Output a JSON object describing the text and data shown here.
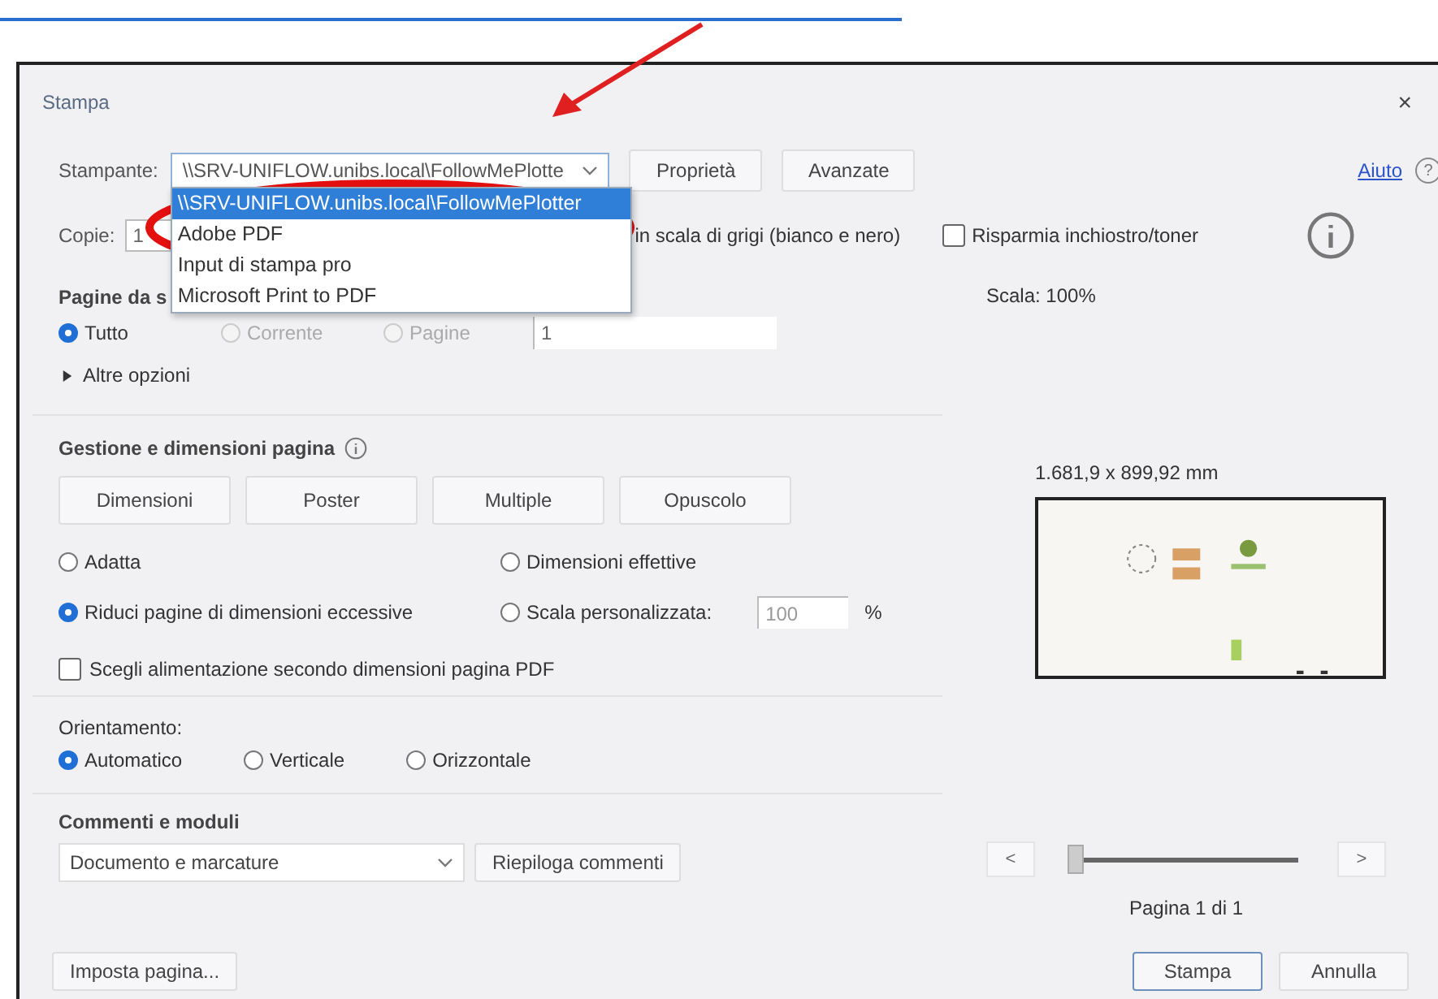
{
  "dialog": {
    "title": "Stampa",
    "close": "×"
  },
  "printer": {
    "label": "Stampante:",
    "value": "\\\\SRV-UNIFLOW.unibs.local\\FollowMePlotte",
    "expanded": true,
    "options": [
      {
        "label": "\\\\SRV-UNIFLOW.unibs.local\\FollowMePlotter",
        "selected": true
      },
      {
        "label": "Adobe PDF",
        "selected": false
      },
      {
        "label": "Input di stampa pro",
        "selected": false
      },
      {
        "label": "Microsoft Print to PDF",
        "selected": false
      }
    ]
  },
  "top_buttons": [
    "Proprietà",
    "Avanzate"
  ],
  "help": {
    "label": "Aiuto",
    "icon": "?"
  },
  "copies": {
    "label": "Copie:",
    "value": "1"
  },
  "grayscale": {
    "label": "in scala di grigi (bianco e nero)"
  },
  "save_ink": {
    "label": "Risparmia inchiostro/toner",
    "checked": false
  },
  "pages": {
    "title": "Pagine da s",
    "radios": [
      {
        "label": "Tutto",
        "selected": true,
        "disabled": false
      },
      {
        "label": "Corrente",
        "selected": false,
        "disabled": true
      },
      {
        "label": "Pagine",
        "selected": false,
        "disabled": true
      }
    ],
    "range": "1",
    "more": {
      "label": "Altre opzioni",
      "expanded": false
    }
  },
  "page_handling": {
    "title": "Gestione e dimensioni pagina",
    "buttons": [
      "Dimensioni",
      "Poster",
      "Multiple",
      "Opuscolo"
    ],
    "radios": [
      {
        "label": "Adatta",
        "selected": false
      },
      {
        "label": "Dimensioni effettive",
        "selected": false
      },
      {
        "label": "Riduci pagine di dimensioni eccessive",
        "selected": true
      },
      {
        "label": "Scala personalizzata:",
        "selected": false
      }
    ],
    "custom_scale": "100",
    "unit": "%",
    "paper_source": {
      "label": "Scegli alimentazione secondo dimensioni pagina PDF",
      "checked": false
    }
  },
  "orientation": {
    "label": "Orientamento:",
    "radios": [
      {
        "label": "Automatico",
        "selected": true
      },
      {
        "label": "Verticale",
        "selected": false
      },
      {
        "label": "Orizzontale",
        "selected": false
      }
    ]
  },
  "comments": {
    "title": "Commenti e moduli",
    "value": "Documento e marcature",
    "button": "Riepiloga commenti"
  },
  "preview": {
    "scale": "Scala: 100%",
    "size": "1.681,9 x 899,92 mm",
    "prev": "<",
    "next": ">",
    "slider": {
      "level": 0
    },
    "page": "Pagina 1 di 1"
  },
  "footer": {
    "setup": "Imposta pagina...",
    "print": "Stampa",
    "cancel": "Annulla"
  }
}
